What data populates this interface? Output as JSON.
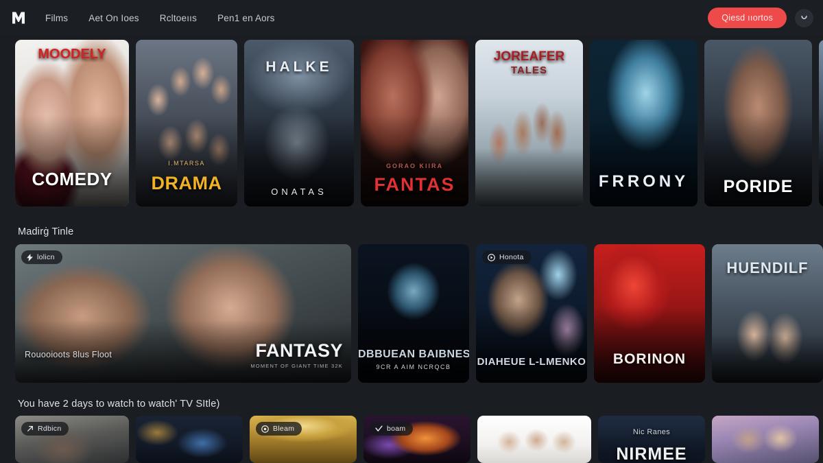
{
  "header": {
    "logo_icon": "m-monogram-logo",
    "nav": [
      {
        "label": "Films"
      },
      {
        "label": "Aet On Ioes"
      },
      {
        "label": "Rcltoeııs"
      },
      {
        "label": "Pen1 en Aors"
      }
    ],
    "cta_label": "Qiesd ııortos",
    "cta_color": "#ef4a4a",
    "avatar_icon": "user-avatar-icon"
  },
  "rows": [
    {
      "title": "",
      "cards": [
        {
          "name": "comedy",
          "art": "art-comedy",
          "title": "COMEDY",
          "title_size": 26,
          "title_color": "#ffffff",
          "top_title": "MOODELY",
          "top_color": "#d8201f",
          "top_size": 20,
          "sub": ""
        },
        {
          "name": "drama",
          "art": "art-drama",
          "title": "DRAMA",
          "title_size": 27,
          "title_color": "#f2b227",
          "top_title": "",
          "top_color": "",
          "top_size": 0,
          "sub": "I.MTARSA"
        },
        {
          "name": "halke",
          "art": "art-halke",
          "title": "ONATAS",
          "title_size": 13,
          "title_color": "#e6eaf0",
          "top_title": "HALKE",
          "top_color": "#e9eef4",
          "top_size": 21,
          "sub": ""
        },
        {
          "name": "fantas",
          "art": "art-fantas",
          "title": "FANTAS",
          "title_size": 27,
          "title_color": "#e03232",
          "top_title": "",
          "top_color": "",
          "top_size": 0,
          "sub": "GORAO KIIRA"
        },
        {
          "name": "joreafer-tales",
          "art": "art-joreafer",
          "title": "",
          "title_size": 0,
          "title_color": "",
          "top_title": "JOREAFER",
          "top_color": "#a81e22",
          "top_size": 19,
          "sub": "TALES"
        },
        {
          "name": "frrony",
          "art": "art-frrony",
          "title": "FRRONY",
          "title_size": 24,
          "title_color": "#e9eff6",
          "top_title": "",
          "top_color": "",
          "top_size": 0,
          "sub": ""
        },
        {
          "name": "poride",
          "art": "art-poride",
          "title": "PORIDE",
          "title_size": 25,
          "title_color": "#ffffff",
          "top_title": "",
          "top_color": "",
          "top_size": 0,
          "sub": ""
        },
        {
          "name": "edge-card",
          "art": "art-edge1",
          "title": "",
          "title_size": 0,
          "title_color": "",
          "top_title": "",
          "top_color": "",
          "top_size": 0,
          "sub": ""
        }
      ]
    },
    {
      "title": "Madirġ Tinle",
      "featured": {
        "name": "featured-fantasy",
        "art": "art-wide",
        "badge": {
          "icon": "bolt-icon",
          "label": "lolicn"
        },
        "caption": "Rouooioots 8lus Floot",
        "genre": "FANTASY",
        "genre_sub": "MOMENT OF GIANT TIME  32K"
      },
      "cards": [
        {
          "name": "dbbuean-baibnes",
          "art": "art-dbbuean",
          "title": "DBBUEAN BAIBNES",
          "title_size": 16,
          "title_color": "#c9d6e2",
          "sub": "9CR A AIM NCRQCB",
          "badge_label": "",
          "badge_icon": ""
        },
        {
          "name": "diaheue-lmenko",
          "art": "art-diaheue",
          "title": "DIAHEUE L-LMENKO",
          "title_size": 15,
          "title_color": "#d0d9e4",
          "sub": "",
          "badge_label": "Honota",
          "badge_icon": "play-circle-icon"
        },
        {
          "name": "borinon",
          "art": "art-borinon",
          "title": "BORINON",
          "title_size": 21,
          "title_color": "#f3f0ee",
          "sub": "",
          "badge_label": "",
          "badge_icon": ""
        },
        {
          "name": "huendilf",
          "art": "art-huendilf",
          "title": "HUENDILF",
          "title_size": 22,
          "title_color": "#dfe7ef",
          "sub": "",
          "badge_label": "",
          "badge_icon": "",
          "title_top": true
        },
        {
          "name": "edge-card-2",
          "art": "art-edge2",
          "title": "",
          "title_size": 0,
          "title_color": "",
          "sub": "",
          "badge_label": "",
          "badge_icon": ""
        }
      ]
    },
    {
      "title": "You have 2 days to watch to watchʹ TV SItle)",
      "cards": [
        {
          "name": "bottom-1",
          "art": "art-b1",
          "badge_label": "Rdbicn",
          "badge_icon": "arrow-icon",
          "title": "",
          "kicker": ""
        },
        {
          "name": "bottom-2",
          "art": "art-b2",
          "badge_label": "",
          "badge_icon": "",
          "title": "",
          "kicker": ""
        },
        {
          "name": "bottom-3",
          "art": "art-b3",
          "badge_label": "Bleam",
          "badge_icon": "circle-icon",
          "title": "",
          "kicker": ""
        },
        {
          "name": "bottom-4",
          "art": "art-b4",
          "badge_label": "boam",
          "badge_icon": "check-icon",
          "title": "",
          "kicker": ""
        },
        {
          "name": "bottom-5",
          "art": "art-b5",
          "badge_label": "",
          "badge_icon": "",
          "title": "",
          "kicker": ""
        },
        {
          "name": "bottom-6",
          "art": "art-b6",
          "badge_label": "",
          "badge_icon": "",
          "title": "NIRMEE",
          "kicker": "Nic Ranes"
        },
        {
          "name": "bottom-7",
          "art": "art-b7",
          "badge_label": "",
          "badge_icon": "",
          "title": "",
          "kicker": ""
        },
        {
          "name": "bottom-8",
          "art": "art-b8",
          "badge_label": "",
          "badge_icon": "",
          "title": "",
          "kicker": ""
        }
      ]
    }
  ]
}
